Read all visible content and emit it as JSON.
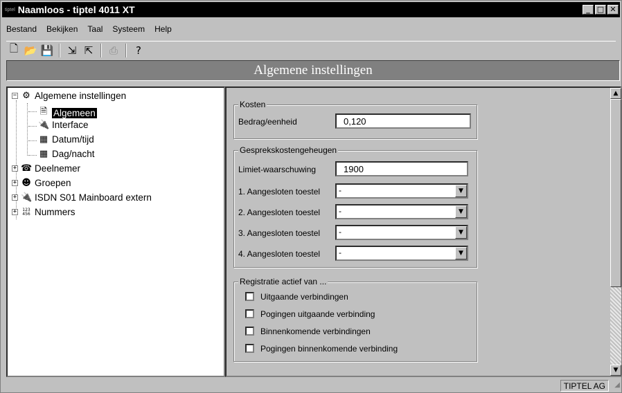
{
  "window": {
    "app_icon_text": "tiptel",
    "title": "Naamloos - tiptel 4011 XT",
    "minimize": "_",
    "maximize": "□",
    "close": "✕"
  },
  "menu": [
    "Bestand",
    "Bekijken",
    "Taal",
    "Systeem",
    "Help"
  ],
  "toolbar": {
    "icons": [
      "new-icon",
      "open-icon",
      "save-icon",
      "upload-icon",
      "download-icon",
      "print-icon",
      "help-icon"
    ]
  },
  "header": {
    "title": "Algemene instellingen"
  },
  "tree": {
    "root": "Algemene instellingen",
    "children": [
      "Algemeen",
      "Interface",
      "Datum/tijd",
      "Dag/nacht"
    ],
    "others": [
      "Deelnemer",
      "Groepen",
      "ISDN S01 Mainboard extern",
      "Nummers"
    ],
    "numbers_icon_text": "123\n456"
  },
  "kosten": {
    "legend": "Kosten",
    "label": "Bedrag/eenheid",
    "value": "0,120"
  },
  "geheugen": {
    "legend": "Gesprekskostengeheugen",
    "limit_label": "Limiet-waarschuwing",
    "limit_value": "1900",
    "devices": [
      {
        "label": "1. Aangesloten toestel",
        "value": "-"
      },
      {
        "label": "2. Aangesloten toestel",
        "value": "-"
      },
      {
        "label": "3. Aangesloten toestel",
        "value": "-"
      },
      {
        "label": "4. Aangesloten toestel",
        "value": "-"
      }
    ]
  },
  "registratie": {
    "legend": "Registratie actief van ...",
    "options": [
      {
        "label": "Uitgaande verbindingen",
        "checked": false
      },
      {
        "label": "Pogingen uitgaande verbinding",
        "checked": false
      },
      {
        "label": "Binnenkomende verbindingen",
        "checked": false
      },
      {
        "label": "Pogingen binnenkomende verbinding",
        "checked": false
      }
    ]
  },
  "status": {
    "company": "TIPTEL AG"
  }
}
